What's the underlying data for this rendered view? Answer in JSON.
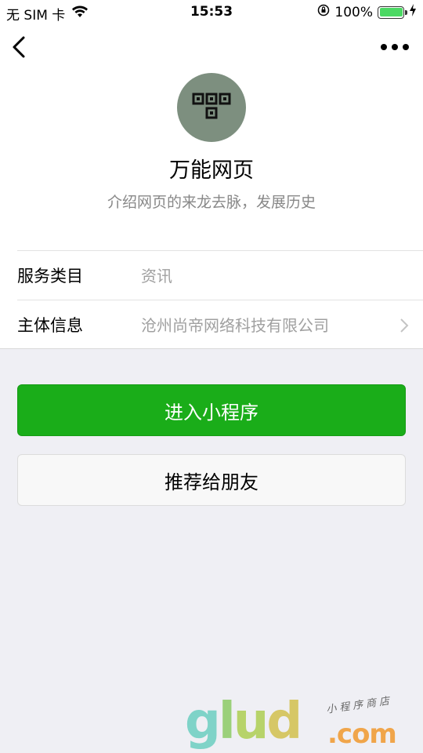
{
  "status_bar": {
    "carrier": "无 SIM 卡",
    "time": "15:53",
    "battery_text": "100%"
  },
  "nav": {
    "back_icon": "chevron-left-icon",
    "more_icon": "more-dots-icon"
  },
  "app": {
    "name": "万能网页",
    "description": "介绍网页的来龙去脉，发展历史",
    "logo_color": "#7d8f7f"
  },
  "info_rows": [
    {
      "label": "服务类目",
      "value": "资讯"
    },
    {
      "label": "主体信息",
      "value": "沧州尚帝网络科技有限公司"
    }
  ],
  "buttons": {
    "enter": "进入小程序",
    "share": "推荐给朋友"
  },
  "colors": {
    "primary_green": "#1aad19",
    "background": "#efeff4"
  },
  "watermark": {
    "g": "g",
    "l": "l",
    "u": "u",
    "d": "d",
    "com": ".com",
    "tag": "小程序商店"
  }
}
